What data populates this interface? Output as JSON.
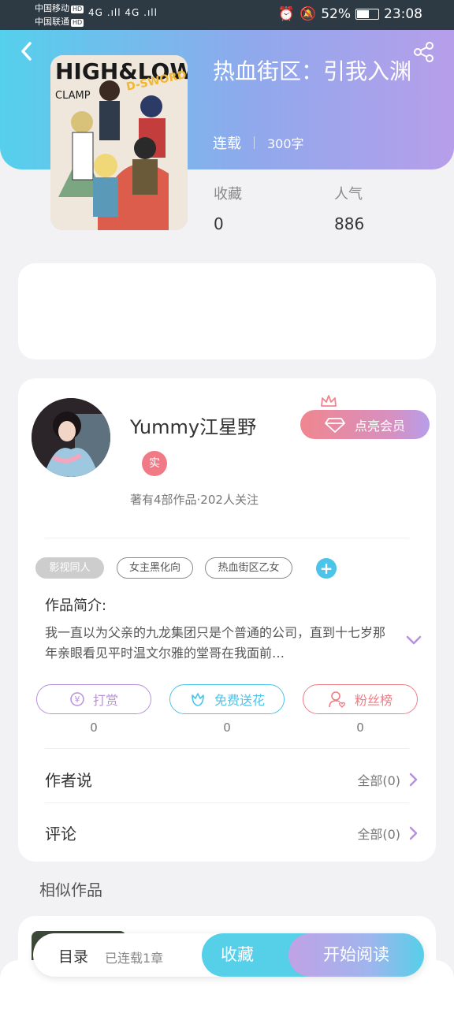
{
  "status_bar": {
    "carrier1": "中国移动",
    "carrier2": "中国联通",
    "hd": "HD",
    "network": "4G .ıll 4G .ıll",
    "battery": "52%",
    "time": "23:08"
  },
  "book": {
    "title": "热血街区：引我入渊",
    "status": "连载",
    "word_count": "300字",
    "cover_art_text": "HIGH&LOW",
    "cover_subtext": "CLAMP",
    "cover_badge": "D-SWORD"
  },
  "stats": {
    "favorites_label": "收藏",
    "favorites_value": "0",
    "popularity_label": "人气",
    "popularity_value": "886"
  },
  "author": {
    "name": "Yummy江星野",
    "real_badge": "实",
    "stats": "著有4部作品·202人关注",
    "vip_button": "点亮会员"
  },
  "tags": [
    "影视同人",
    "女主黑化向",
    "热血街区乙女"
  ],
  "intro": {
    "title": "作品简介:",
    "text": "我一直以为父亲的九龙集团只是个普通的公司，直到十七岁那年亲眼看见平时温文尔雅的堂哥在我面前…"
  },
  "actions": [
    {
      "label": "打赏",
      "count": "0",
      "color": "#b890dc"
    },
    {
      "label": "免费送花",
      "count": "0",
      "color": "#4cc3e8"
    },
    {
      "label": "粉丝榜",
      "count": "0",
      "color": "#ef7d86"
    }
  ],
  "author_says": {
    "label": "作者说",
    "right": "全部(0)"
  },
  "comments": {
    "label": "评论",
    "right": "全部(0)"
  },
  "similar_title": "相似作品",
  "bottom": {
    "toc": "目录",
    "chapters": "已连载1章",
    "collect": "收藏",
    "read": "开始阅读"
  },
  "colors": {
    "header_start": "#55d0ec",
    "header_end": "#b79eea",
    "accent_purple": "#b890dc",
    "accent_cyan": "#4cc3e8",
    "accent_red": "#ef7d86"
  }
}
